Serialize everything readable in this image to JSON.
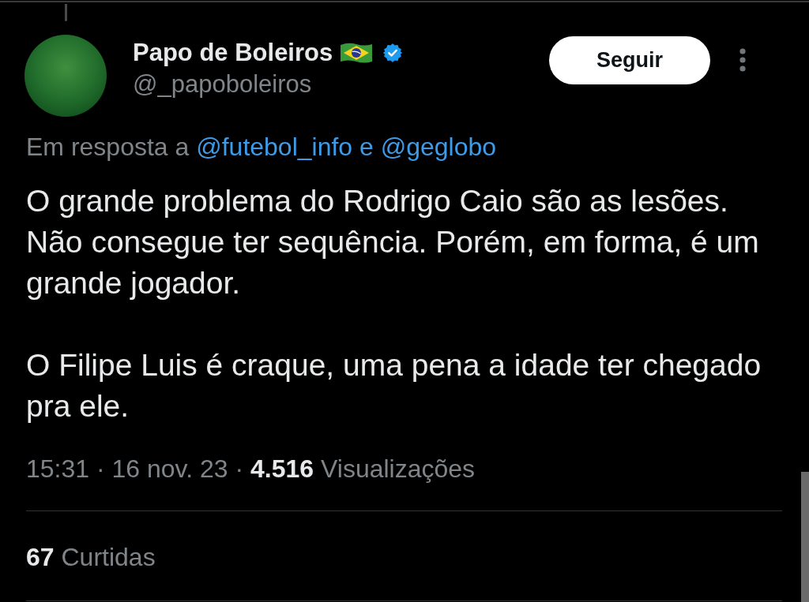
{
  "tweet": {
    "in_thread": true,
    "author": {
      "name": "Papo de Boleiros",
      "verified": true,
      "handle": "@_papoboleiros"
    },
    "follow_button": {
      "label": "Seguir"
    },
    "reply_to": {
      "prefix": "Em resposta a",
      "mentions": [
        "@futebol_info",
        "@geglobo"
      ],
      "joiner": "e"
    },
    "text": "O grande problema do Rodrigo Caio são as lesões.\nNão consegue ter sequência. Porém, em forma, é um grande jogador.\n\nO Filipe Luis é craque, uma pena a idade ter chegado pra ele.",
    "meta": "15:31 · 16 nov. 23 · **4.516** Visualizações",
    "likes": "**67** Curtidas"
  }
}
